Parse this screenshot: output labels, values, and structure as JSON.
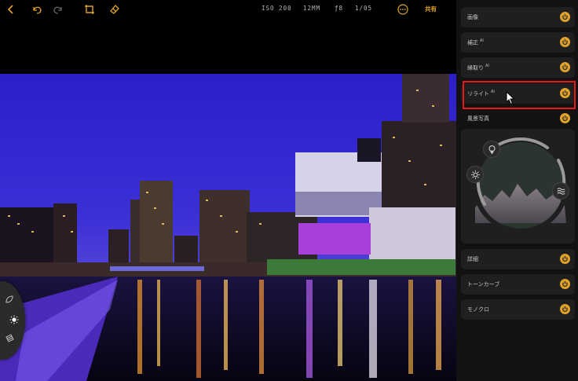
{
  "toolbar": {
    "icons": [
      "back-icon",
      "undo-icon",
      "redo-icon",
      "crop-icon",
      "eraser-icon",
      "more-icon"
    ],
    "iso": "ISO 200",
    "focal": "12MM",
    "aperture": "ƒ8",
    "shutter": "1/05",
    "share_label": "共有"
  },
  "panel": {
    "items": [
      {
        "label": "画像",
        "ai": ""
      },
      {
        "label": "補正",
        "ai": "AI"
      },
      {
        "label": "縁取り",
        "ai": "AI"
      },
      {
        "label": "リライト",
        "ai": "AI"
      },
      {
        "label": "風景写真",
        "ai": ""
      },
      {
        "label": "詳細",
        "ai": ""
      },
      {
        "label": "トーンカーブ",
        "ai": ""
      },
      {
        "label": "モノクロ",
        "ai": ""
      }
    ],
    "landscape_icons": [
      "tree-icon",
      "sun-icon",
      "water-icon"
    ]
  },
  "left_tools": [
    "foliage-icon",
    "brightness-icon",
    "texture-icon"
  ],
  "colors": {
    "accent": "#e0a32a",
    "highlight": "#e31b1b",
    "sky": "#2a22c8"
  }
}
